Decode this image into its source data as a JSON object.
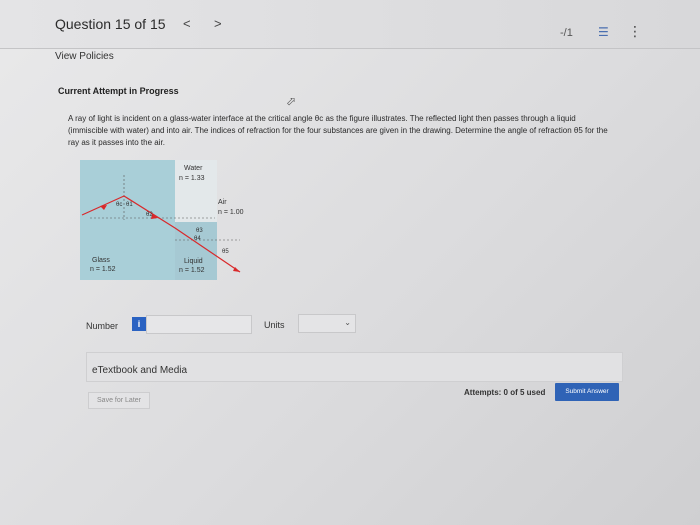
{
  "header": {
    "question_title": "Question 15 of 15",
    "prev_glyph": "<",
    "next_glyph": ">",
    "score": "-/1",
    "list_icon": "list-icon",
    "menu_icon": "kebab-menu-icon"
  },
  "policies_link": "View Policies",
  "attempt_heading": "Current Attempt in Progress",
  "question": {
    "text": "A ray of light is incident on a glass-water interface at the critical angle θc as the figure illustrates. The reflected light then passes through a liquid (immiscible with water) and into air. The indices of refraction for the four substances are given in the drawing. Determine the angle of refraction θ5 for the ray as it passes into the air."
  },
  "figure": {
    "water_label": "Water",
    "water_n": "n = 1.33",
    "air_label": "Air",
    "air_n": "n = 1.00",
    "glass_label": "Glass",
    "glass_n": "n = 1.52",
    "liquid_label": "Liquid",
    "liquid_n": "n = 1.52",
    "theta_c": "θc",
    "theta_1": "θ1",
    "theta_2": "θ2",
    "theta_3": "θ3",
    "theta_4": "θ4",
    "theta_5": "θ5",
    "colors": {
      "glass": "#a9cfd8",
      "liquid": "#a6c9d3",
      "ray": "#d9282a"
    }
  },
  "answer": {
    "number_label": "Number",
    "info_glyph": "i",
    "number_value": "",
    "units_label": "Units",
    "units_value": ""
  },
  "etextbook": "eTextbook and Media",
  "save_label": "Save for Later",
  "attempts_text": "Attempts: 0 of 5 used",
  "submit_label": "Submit Answer"
}
